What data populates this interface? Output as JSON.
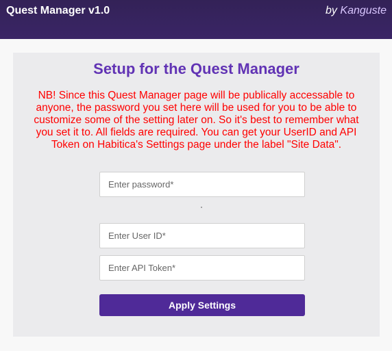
{
  "header": {
    "app_title": "Quest Manager v1.0",
    "by_word": "by",
    "author": "Kanguste"
  },
  "setup": {
    "title": "Setup for the Quest Manager",
    "notice": "NB! Since this Quest Manager page will be publically accessable to anyone, the password you set here will be used for you to be able to customize some of the setting later on. So it's best to remember what you set it to. All fields are required. You can get your UserID and API Token on Habitica's Settings page under the label \"Site Data\".",
    "password_placeholder": "Enter password*",
    "password_value": "",
    "user_id_placeholder": "Enter User ID*",
    "user_id_value": "",
    "api_token_placeholder": "Enter API Token*",
    "api_token_value": "",
    "apply_label": "Apply Settings"
  },
  "colors": {
    "header_bg": "#332257",
    "title": "#6133b4",
    "notice": "#ff0000",
    "button": "#4f2a98"
  }
}
